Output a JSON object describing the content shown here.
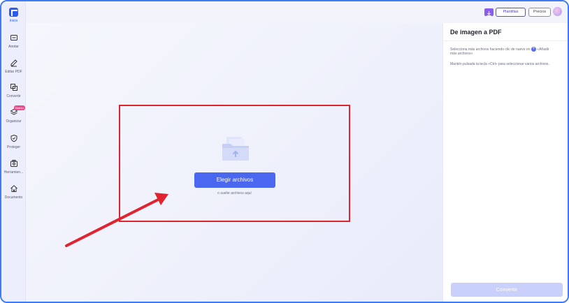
{
  "sidebar": {
    "logo_label": "Inicio",
    "items": [
      {
        "label": "Anotar",
        "icon": "annotate-icon"
      },
      {
        "label": "Editar PDF",
        "icon": "edit-pdf-icon"
      },
      {
        "label": "Convertir",
        "icon": "convert-icon"
      },
      {
        "label": "Organizar",
        "icon": "organize-icon",
        "badge": "Nuevo"
      },
      {
        "label": "Proteger",
        "icon": "shield-icon"
      },
      {
        "label": "Herramien...",
        "icon": "tools-icon"
      },
      {
        "label": "Documento",
        "icon": "home-icon"
      }
    ]
  },
  "topbar": {
    "templates_label": "Plantillas",
    "pricing_label": "Precios",
    "download_icon": "download-icon",
    "avatar_icon": "avatar"
  },
  "main": {
    "choose_button": "Elegir archivos",
    "drop_text": "o suelte archivos aquí",
    "folder_icon": "folder-upload-icon",
    "accent_red": "#e0242f",
    "accent_blue": "#4a67f0"
  },
  "panel": {
    "title": "De imagen a PDF",
    "hint1_before": "Selecciona más archivos haciendo clic de nuevo en",
    "hint1_plus": "+",
    "hint1_after": "«Añadir más archivos».",
    "hint2": "Mantén pulsada la tecla «Ctrl» para seleccionar varios archivos.",
    "convert_button": "Convertir"
  }
}
